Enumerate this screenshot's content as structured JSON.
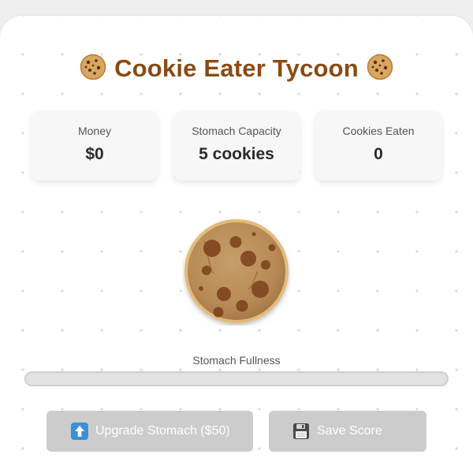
{
  "header": {
    "title": "Cookie Eater Tycoon",
    "left_icon": "cookie-icon",
    "right_icon": "cookie-icon"
  },
  "stats": {
    "money": {
      "label": "Money",
      "value": "$0"
    },
    "stomach_capacity": {
      "label": "Stomach Capacity",
      "value": "5 cookies"
    },
    "cookies_eaten": {
      "label": "Cookies Eaten",
      "value": "0"
    }
  },
  "cookie": {
    "icon": "cookie-icon"
  },
  "fullness": {
    "label": "Stomach Fullness",
    "fraction": 0
  },
  "buttons": {
    "upgrade": {
      "icon": "up-arrow-icon",
      "label": "Upgrade Stomach ($50)"
    },
    "save": {
      "icon": "floppy-disk-icon",
      "label": "Save Score"
    }
  },
  "colors": {
    "title": "#8a4a13",
    "button_disabled": "#cccccc",
    "cookie": "#c99a5b",
    "chip": "#7b3f1b"
  }
}
